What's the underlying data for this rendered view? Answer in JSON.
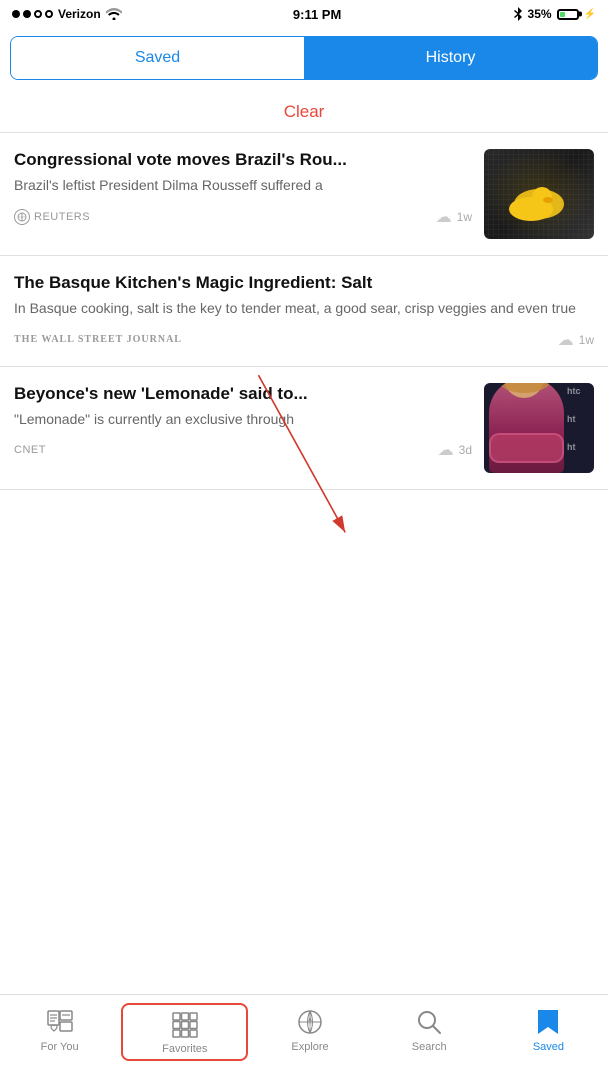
{
  "statusBar": {
    "carrier": "Verizon",
    "time": "9:11 PM",
    "battery": "35%"
  },
  "tabs": {
    "saved": "Saved",
    "history": "History"
  },
  "clear": "Clear",
  "articles": [
    {
      "id": 1,
      "title": "Congressional vote moves Brazil's Rou...",
      "summary": "Brazil's leftist President Dilma Rousseff suffered a",
      "source": "REUTERS",
      "time": "1w",
      "hasThumbnail": true,
      "thumbType": "brazil"
    },
    {
      "id": 2,
      "title": "The Basque Kitchen's Magic Ingredient: Salt",
      "summary": "In Basque cooking, salt is the key to tender meat, a good sear, crisp veggies and even true",
      "source": "THE WALL STREET JOURNAL",
      "time": "1w",
      "hasThumbnail": false,
      "thumbType": null
    },
    {
      "id": 3,
      "title": "Beyonce's new 'Lemonade' said to...",
      "summary": "\"Lemonade\" is currently an exclusive through",
      "source": "cnet",
      "time": "3d",
      "hasThumbnail": true,
      "thumbType": "beyonce"
    }
  ],
  "nav": {
    "items": [
      {
        "id": "for-you",
        "label": "For You",
        "active": false
      },
      {
        "id": "favorites",
        "label": "Favorites",
        "active": false,
        "highlighted": true
      },
      {
        "id": "explore",
        "label": "Explore",
        "active": false
      },
      {
        "id": "search",
        "label": "Search",
        "active": false
      },
      {
        "id": "saved",
        "label": "Saved",
        "active": true
      }
    ]
  },
  "colors": {
    "accent": "#1a88e8",
    "clearRed": "#e8483a",
    "arrowRed": "#d0392b"
  }
}
